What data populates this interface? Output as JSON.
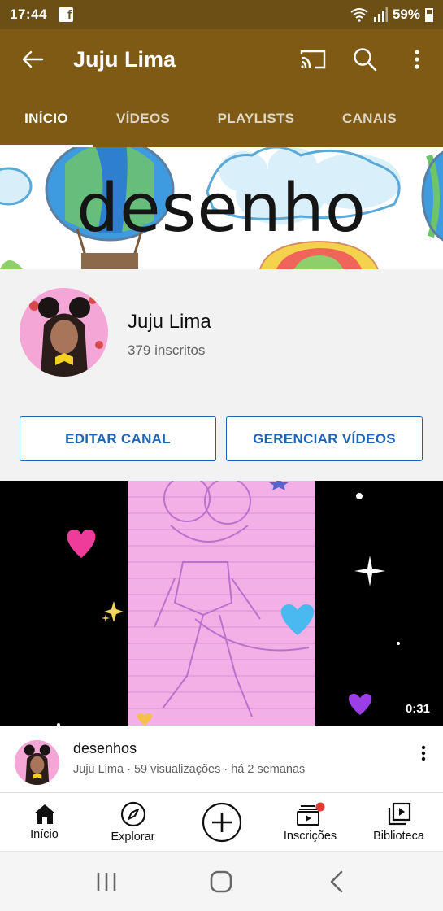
{
  "status_bar": {
    "time": "17:44",
    "battery": "59%",
    "icons": [
      "facebook-icon",
      "wifi-icon",
      "signal-icon",
      "battery-icon"
    ]
  },
  "app_bar": {
    "title": "Juju Lima",
    "icons": [
      "back-arrow-icon",
      "cast-icon",
      "search-icon",
      "more-vert-icon"
    ]
  },
  "tabs": [
    {
      "label": "INÍCIO",
      "active": true
    },
    {
      "label": "VÍDEOS",
      "active": false
    },
    {
      "label": "PLAYLISTS",
      "active": false
    },
    {
      "label": "CANAIS",
      "active": false
    }
  ],
  "banner": {
    "text": "desenho"
  },
  "channel": {
    "name": "Juju Lima",
    "subscribers": "379 inscritos",
    "edit_button": "EDITAR CANAL",
    "manage_button": "GERENCIAR VÍDEOS"
  },
  "video": {
    "duration": "0:31",
    "title": "desenhos",
    "meta": "Juju Lima · 59 visualizações · há 2 semanas"
  },
  "bottom_nav": [
    {
      "label": "Início",
      "icon": "home-icon"
    },
    {
      "label": "Explorar",
      "icon": "compass-icon"
    },
    {
      "label": "",
      "icon": "create-plus-icon"
    },
    {
      "label": "Inscrições",
      "icon": "subscriptions-icon"
    },
    {
      "label": "Biblioteca",
      "icon": "library-icon"
    }
  ],
  "colors": {
    "status_bar": "#6b4f14",
    "app_bar": "#7e5a14",
    "accent_blue": "#1d64b3",
    "notification_dot": "#e53935"
  }
}
